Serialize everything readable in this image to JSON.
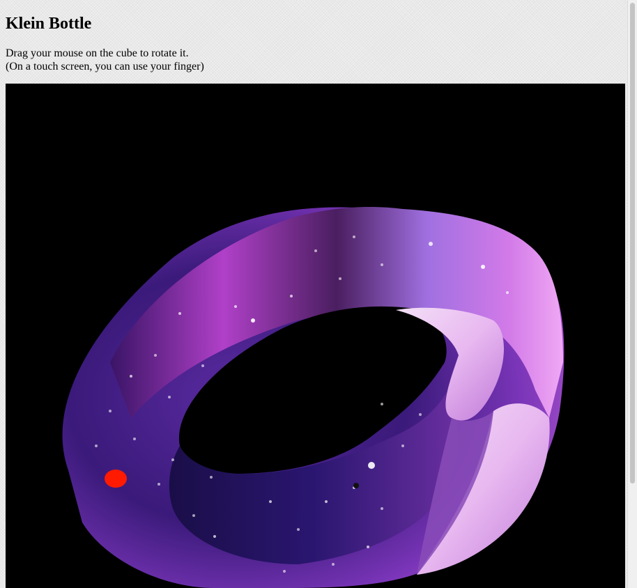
{
  "page": {
    "title": "Klein Bottle",
    "instructions_line1": "Drag your mouse on the cube to rotate it.",
    "instructions_line2": "(On a touch screen, you can use your finger)"
  },
  "scene": {
    "object": "klein-bottle",
    "texture": "galaxy / starfield",
    "background_color": "#000000",
    "surface_colors": [
      "#7b3fb8",
      "#c86ad8",
      "#f0d4f4",
      "#2a1a6e"
    ],
    "marker_color": "#ff1a00"
  }
}
